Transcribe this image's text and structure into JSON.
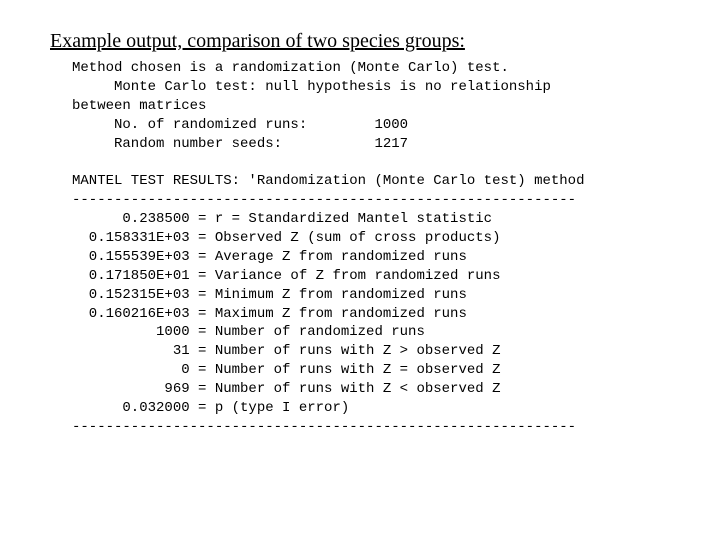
{
  "title": "Example output, comparison of two species groups:",
  "method_lines": [
    "Method chosen is a randomization (Monte Carlo) test.",
    "     Monte Carlo test: null hypothesis is no relationship",
    "between matrices",
    "     No. of randomized runs:        1000",
    "     Random number seeds:           1217"
  ],
  "results_header": "MANTEL TEST RESULTS: 'Randomization (Monte Carlo test) method",
  "divider": "------------------------------------------------------------",
  "results": [
    {
      "value": "0.238500",
      "label": "r = Standardized Mantel statistic"
    },
    {
      "value": "0.158331E+03",
      "label": "Observed Z (sum of cross products)"
    },
    {
      "value": "0.155539E+03",
      "label": "Average Z from randomized runs"
    },
    {
      "value": "0.171850E+01",
      "label": "Variance of Z from randomized runs"
    },
    {
      "value": "0.152315E+03",
      "label": "Minimum Z from randomized runs"
    },
    {
      "value": "0.160216E+03",
      "label": "Maximum Z from randomized runs"
    },
    {
      "value": "1000",
      "label": "Number of randomized runs"
    },
    {
      "value": "31",
      "label": "Number of runs with Z > observed Z"
    },
    {
      "value": "0",
      "label": "Number of runs with Z = observed Z"
    },
    {
      "value": "969",
      "label": "Number of runs with Z < observed Z"
    },
    {
      "value": "0.032000",
      "label": "p (type I error)"
    }
  ]
}
